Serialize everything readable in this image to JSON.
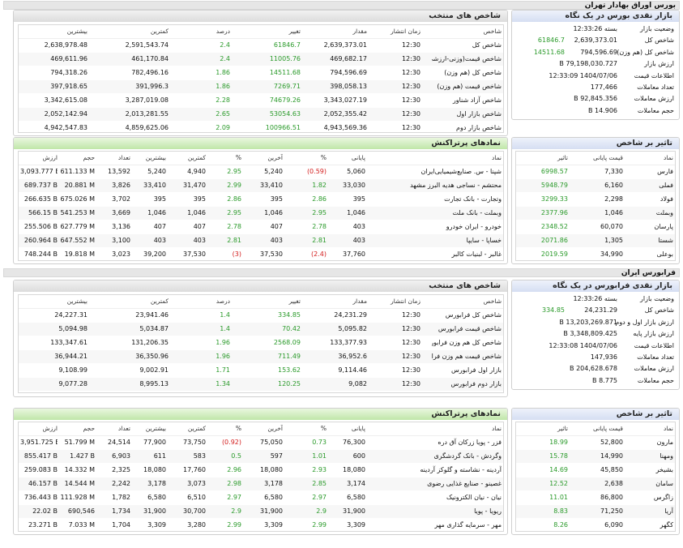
{
  "tse": {
    "title": "بورس اوراق بهادار تهران",
    "index_panel": {
      "title": "شاخص های منتخب",
      "headers": [
        "شاخص",
        "زمان انتشار",
        "مقدار",
        "تغییر",
        "درصد",
        "کمترین",
        "بیشترین"
      ],
      "rows": [
        [
          "شاخص کل",
          "12:30",
          "2,639,373.01",
          "61846.7",
          "2.4",
          "2,591,543.74",
          "2,638,978.48"
        ],
        [
          "شاخص قیمت(وزنی-ارزشی)",
          "12:30",
          "469,682.17",
          "11005.76",
          "2.4",
          "461,170.84",
          "469,611.96"
        ],
        [
          "شاخص کل (هم وزن)",
          "12:30",
          "794,596.69",
          "14511.68",
          "1.86",
          "782,496.16",
          "794,318.26"
        ],
        [
          "شاخص قیمت (هم وزن)",
          "12:30",
          "398,058.13",
          "7269.71",
          "1.86",
          "391,996.3",
          "397,918.65"
        ],
        [
          "شاخص آزاد شناور",
          "12:30",
          "3,343,027.19",
          "74679.26",
          "2.28",
          "3,287,019.08",
          "3,342,615.08"
        ],
        [
          "شاخص بازار اول",
          "12:30",
          "2,052,355.42",
          "53054.63",
          "2.65",
          "2,013,281.55",
          "2,052,142.94"
        ],
        [
          "شاخص بازار دوم",
          "12:30",
          "4,943,569.36",
          "100966.51",
          "2.09",
          "4,859,625.06",
          "4,942,547.83"
        ]
      ]
    },
    "glance": {
      "title": "بازار نقدی بورس در یک نگاه",
      "items": [
        {
          "label": "وضعیت بازار",
          "value": "بسته 12:33:26",
          "change": ""
        },
        {
          "label": "شاخص کل",
          "value": "2,639,373.01",
          "change": "61846.7"
        },
        {
          "label": "شاخص کل (هم وزن)",
          "value": "794,596.69",
          "change": "14511.68"
        },
        {
          "label": "ارزش بازار",
          "value": "79,198,030.727 B",
          "change": ""
        },
        {
          "label": "اطلاعات قیمت",
          "value": "1404/07/06 12:33:09",
          "change": ""
        },
        {
          "label": "تعداد معاملات",
          "value": "177,466",
          "change": ""
        },
        {
          "label": "ارزش معاملات",
          "value": "92,845.356 B",
          "change": ""
        },
        {
          "label": "حجم معاملات",
          "value": "14.906 B",
          "change": ""
        }
      ]
    },
    "active": {
      "title": "نمادهای پرتراکنش",
      "headers": [
        "نماد",
        "پایانی",
        "%",
        "آخرین",
        "%",
        "کمترین",
        "بیشترین",
        "تعداد",
        "حجم",
        "ارزش"
      ],
      "rows": [
        {
          "cells": [
            "شپنا - س. صنایع‌شیمیایی‌ایران",
            "5,060",
            "(0.59)",
            "5,240",
            "2.95",
            "4,940",
            "5,240",
            "13,592",
            "611.133 M",
            "3,093.777 B"
          ],
          "neg": [
            2
          ]
        },
        {
          "cells": [
            "محتشم - نساجی هدیه البرز مشهد",
            "33,030",
            "1.82",
            "33,410",
            "2.99",
            "31,470",
            "33,410",
            "3,826",
            "20.881 M",
            "689.737 B"
          ],
          "neg": []
        },
        {
          "cells": [
            "وتجارت - بانک تجارت",
            "395",
            "2.86",
            "395",
            "2.86",
            "395",
            "395",
            "3,702",
            "675.026 M",
            "266.635 B"
          ],
          "neg": []
        },
        {
          "cells": [
            "وبملت - بانک ملت",
            "1,046",
            "2.95",
            "1,046",
            "2.95",
            "1,046",
            "1,046",
            "3,669",
            "541.253 M",
            "566.15 B"
          ],
          "neg": []
        },
        {
          "cells": [
            "خودرو - ایران‌ خودرو",
            "403",
            "2.78",
            "407",
            "2.78",
            "407",
            "407",
            "3,136",
            "627.779 M",
            "255.506 B"
          ],
          "neg": []
        },
        {
          "cells": [
            "خساپا - سایپا",
            "403",
            "2.81",
            "403",
            "2.81",
            "403",
            "403",
            "3,100",
            "647.552 M",
            "260.964 B"
          ],
          "neg": []
        },
        {
          "cells": [
            "غالبر - لبنیات کالبر",
            "37,760",
            "(2.4)",
            "37,530",
            "(3)",
            "37,530",
            "39,200",
            "3,023",
            "19.818 M",
            "748.244 B"
          ],
          "neg": [
            2,
            4
          ]
        }
      ]
    },
    "impact": {
      "title": "تاثیر بر شاخص",
      "headers": [
        "نماد",
        "قیمت پایانی",
        "تاثیر"
      ],
      "rows": [
        [
          "فارس",
          "7,330",
          "6998.57"
        ],
        [
          "فملی",
          "6,160",
          "5948.79"
        ],
        [
          "فولاد",
          "2,298",
          "3299.33"
        ],
        [
          "وبملت",
          "1,046",
          "2377.96"
        ],
        [
          "پارسان",
          "60,070",
          "2348.52"
        ],
        [
          "شستا",
          "1,305",
          "2071.86"
        ],
        [
          "بوعلی",
          "34,990",
          "2019.59"
        ]
      ]
    }
  },
  "ifb": {
    "title": "فرابورس ایران",
    "index_panel": {
      "title": "شاخص های منتخب",
      "headers": [
        "شاخص",
        "زمان انتشار",
        "مقدار",
        "تغییر",
        "درصد",
        "کمترین",
        "بیشترین"
      ],
      "rows": [
        [
          "شاخص کل فرابورس",
          "12:30",
          "24,231.29",
          "334.85",
          "1.4",
          "23,941.46",
          "24,227.31"
        ],
        [
          "شاخص قیمت فرابورس",
          "12:30",
          "5,095.82",
          "70.42",
          "1.4",
          "5,034.87",
          "5,094.98"
        ],
        [
          "شاخص کل هم وزن فرابورس",
          "12:30",
          "133,377.93",
          "2568.09",
          "1.96",
          "131,206.35",
          "133,347.61"
        ],
        [
          "شاخص قیمت هم وزن فرابو...",
          "12:30",
          "36,952.6",
          "711.49",
          "1.96",
          "36,350.96",
          "36,944.21"
        ],
        [
          "بازار اول فرابورس",
          "12:30",
          "9,114.46",
          "153.62",
          "1.71",
          "9,002.91",
          "9,108.99"
        ],
        [
          "بازار دوم فرابورس",
          "12:30",
          "9,082",
          "120.25",
          "1.34",
          "8,995.13",
          "9,077.28"
        ]
      ]
    },
    "glance": {
      "title": "بازار نقدی فرابورس در یک نگاه",
      "items": [
        {
          "label": "وضعیت بازار",
          "value": "بسته 12:33:26",
          "change": ""
        },
        {
          "label": "شاخص کل",
          "value": "24,231.29",
          "change": "334.85"
        },
        {
          "label": "ارزش بازار اول و دوم",
          "value": "13,203,269.871 B",
          "change": ""
        },
        {
          "label": "ارزش بازار پایه",
          "value": "3,348,809.425 B",
          "change": ""
        },
        {
          "label": "اطلاعات قیمت",
          "value": "1404/07/06 12:33:08",
          "change": ""
        },
        {
          "label": "تعداد معاملات",
          "value": "147,936",
          "change": ""
        },
        {
          "label": "ارزش معاملات",
          "value": "204,628.678 B",
          "change": ""
        },
        {
          "label": "حجم معاملات",
          "value": "8.775 B",
          "change": ""
        }
      ]
    },
    "active": {
      "title": "نمادهای پرتراکنش",
      "headers": [
        "نماد",
        "پایانی",
        "%",
        "آخرین",
        "%",
        "کمترین",
        "بیشترین",
        "تعداد",
        "حجم",
        "ارزش"
      ],
      "rows": [
        {
          "cells": [
            "فزر - پویا زرکان آق دره",
            "76,300",
            "0.73",
            "75,050",
            "(0.92)",
            "73,750",
            "77,900",
            "24,514",
            "51.799 M",
            "3,951.725 B"
          ],
          "neg": [
            4
          ]
        },
        {
          "cells": [
            "وگردش - بانک گردشگری",
            "600",
            "1.01",
            "597",
            "0.5",
            "583",
            "611",
            "6,903",
            "1.427 B",
            "855.417 B"
          ],
          "neg": []
        },
        {
          "cells": [
            "آردینه - نشاسته و گلوکز آردینه",
            "18,080",
            "2.93",
            "18,080",
            "2.96",
            "17,760",
            "18,080",
            "2,325",
            "14.332 M",
            "259.083 B"
          ],
          "neg": []
        },
        {
          "cells": [
            "غصینو - صنایع غذایی رضوی",
            "3,174",
            "2.85",
            "3,178",
            "2.98",
            "3,073",
            "3,178",
            "2,242",
            "14.544 M",
            "46.157 B"
          ],
          "neg": []
        },
        {
          "cells": [
            "نیان - نیان الکترونیک",
            "6,580",
            "2.97",
            "6,580",
            "2.97",
            "6,510",
            "6,580",
            "1,782",
            "111.928 M",
            "736.443 B"
          ],
          "neg": []
        },
        {
          "cells": [
            "ریویا - پویا",
            "31,900",
            "2.9",
            "31,900",
            "2.9",
            "30,700",
            "31,900",
            "1,734",
            "690,546",
            "22.02 B"
          ],
          "neg": []
        },
        {
          "cells": [
            "مهر - سرمایه گذاری مهر",
            "3,309",
            "2.99",
            "3,309",
            "2.99",
            "3,280",
            "3,309",
            "1,704",
            "7.033 M",
            "23.271 B"
          ],
          "neg": []
        }
      ]
    },
    "impact": {
      "title": "تاثیر بر شاخص",
      "headers": [
        "نماد",
        "قیمت پایانی",
        "تاثیر"
      ],
      "rows": [
        [
          "مارون",
          "52,800",
          "18.99"
        ],
        [
          "ومهنا",
          "14,990",
          "15.78"
        ],
        [
          "بشیخر",
          "45,850",
          "14.69"
        ],
        [
          "سامان",
          "2,638",
          "12.52"
        ],
        [
          "زاگرس",
          "86,800",
          "11.01"
        ],
        [
          "آریا",
          "71,250",
          "8.83"
        ],
        [
          "کگهر",
          "6,090",
          "8.26"
        ]
      ]
    }
  },
  "colors": {
    "positive": "#2a9a2a",
    "negative": "#d31c1c",
    "header_green": "#bfe6a8",
    "header_blue": "#d5def2"
  }
}
